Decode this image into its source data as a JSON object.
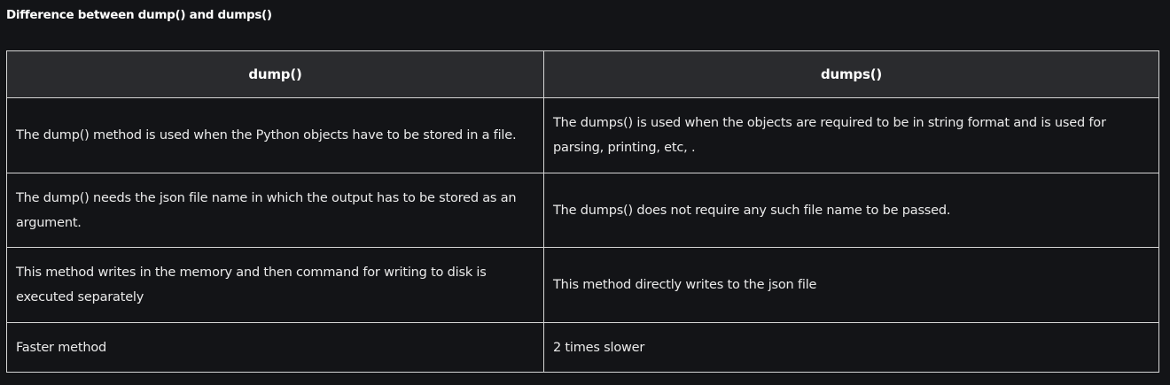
{
  "title": "Difference between dump() and dumps()",
  "table": {
    "headers": [
      "dump()",
      "dumps()"
    ],
    "rows": [
      [
        "The dump() method is used when the Python objects have to be stored in a file.",
        "The dumps() is used when the objects are required to be in string format and is used for parsing, printing, etc, ."
      ],
      [
        "The dump() needs the json file name in which the output has to be stored as an argument.",
        "The dumps() does not require any such file name to be passed."
      ],
      [
        "This method writes in the memory and then command for writing to disk is executed separately",
        "This method directly writes to the json file"
      ],
      [
        "Faster method",
        "2 times slower"
      ]
    ]
  }
}
